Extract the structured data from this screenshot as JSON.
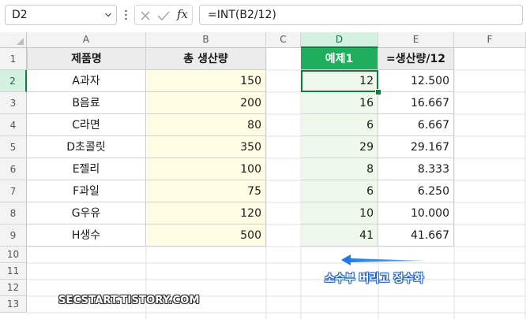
{
  "formula_bar": {
    "name_box": "D2",
    "fx_label": "fx",
    "formula": "=INT(B2/12)"
  },
  "columns": [
    "A",
    "B",
    "C",
    "D",
    "E",
    "F"
  ],
  "rows": [
    "1",
    "2",
    "3",
    "4",
    "5",
    "6",
    "7",
    "8",
    "9",
    "10",
    "11",
    "12",
    "13"
  ],
  "headers": {
    "product": "제품명",
    "total": "총 생산량",
    "example": "예제1",
    "formula_col": "=생산량/12"
  },
  "data_rows": [
    {
      "name": "A과자",
      "total": "150",
      "int": "12",
      "div": "12.500"
    },
    {
      "name": "B음료",
      "total": "200",
      "int": "16",
      "div": "16.667"
    },
    {
      "name": "C라면",
      "total": "80",
      "int": "6",
      "div": "6.667"
    },
    {
      "name": "D초콜릿",
      "total": "350",
      "int": "29",
      "div": "29.167"
    },
    {
      "name": "E젤리",
      "total": "100",
      "int": "8",
      "div": "8.333"
    },
    {
      "name": "F과일",
      "total": "75",
      "int": "6",
      "div": "6.250"
    },
    {
      "name": "G우유",
      "total": "120",
      "int": "10",
      "div": "10.000"
    },
    {
      "name": "H생수",
      "total": "500",
      "int": "41",
      "div": "41.667"
    }
  ],
  "annotation": "소수부 버리고 정수화",
  "watermark": "SECSTART.TISTORY.COM",
  "colors": {
    "accent_green": "#107c41",
    "header_green": "#1fae5b",
    "yellow_fill": "#fffde4",
    "green_fill": "#eef8ea",
    "arrow_blue": "#1b73e8"
  },
  "icons": [
    "chevron-down-icon",
    "more-options-icon",
    "cancel-icon",
    "confirm-icon",
    "function-icon",
    "arrow-left-icon"
  ]
}
